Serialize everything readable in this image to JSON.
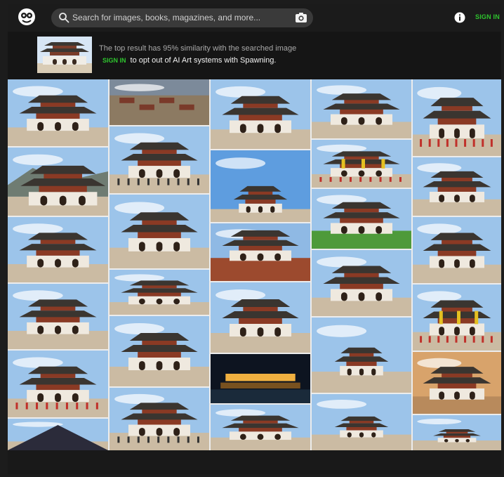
{
  "search": {
    "placeholder": "Search for images, books, magazines, and more..."
  },
  "header": {
    "sign_in": "SIGN IN"
  },
  "banner": {
    "similarity_text": "The top result has 95% similarity with the searched image",
    "sign_in": "SIGN IN",
    "opt_out_text": "to opt out of AI Art systems with Spawning."
  },
  "icons": {
    "logo": "owl-logo-icon",
    "search": "search-icon",
    "camera": "camera-icon",
    "info": "info-icon"
  },
  "colors": {
    "accent": "#2ec52e",
    "background": "#1c1c1c",
    "search_bg": "#3a3a3a"
  }
}
